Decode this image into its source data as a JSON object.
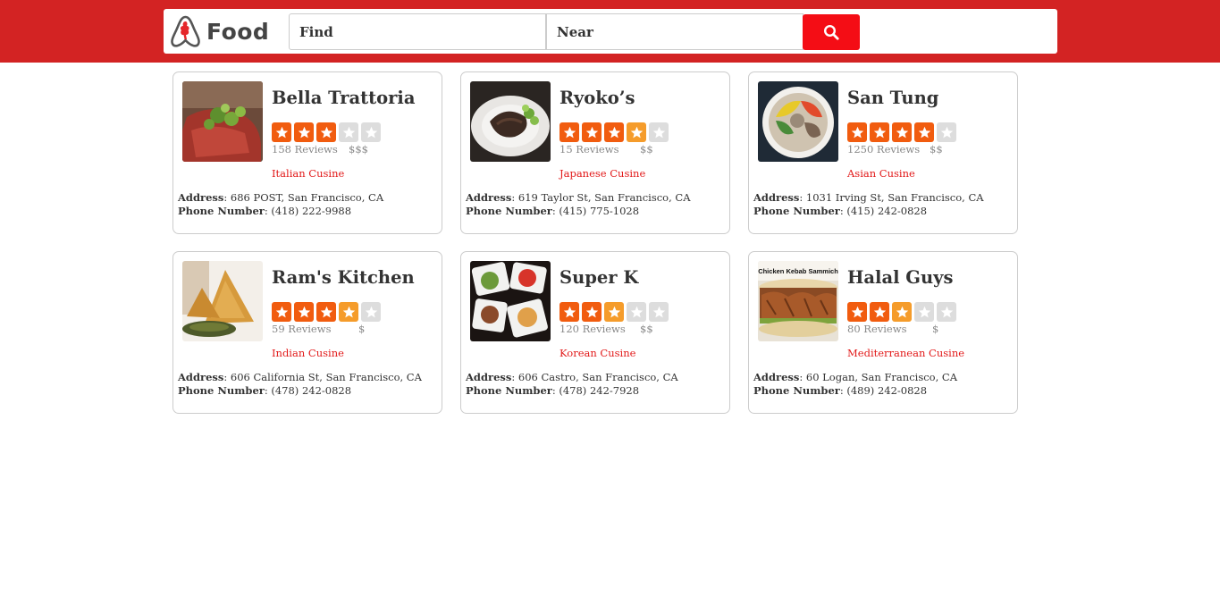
{
  "app": {
    "logo_text": "Food"
  },
  "search": {
    "find_placeholder": "Find",
    "near_placeholder": "Near",
    "button_icon": "search-icon"
  },
  "colors": {
    "topbar": "#d32323",
    "search_button": "#f40d15",
    "star_full": "#f15c0f",
    "star_half": "#f59c2b",
    "star_empty": "#dddddd",
    "cuisine": "#e21a1a"
  },
  "labels": {
    "address": "Address",
    "phone": "Phone Number"
  },
  "restaurants": [
    {
      "name": "Bella Trattoria",
      "rating": 3,
      "reviews": "158 Reviews",
      "price": "$$$",
      "cuisine": "Italian Cusine",
      "address": "686 POST, San Francisco, CA",
      "phone": "(418) 222-9988"
    },
    {
      "name": "Ryoko’s",
      "rating": 3.5,
      "reviews": "15 Reviews",
      "price": "$$",
      "cuisine": "Japanese Cusine",
      "address": "619 Taylor St, San Francisco, CA",
      "phone": "(415) 775-1028"
    },
    {
      "name": "San Tung",
      "rating": 4,
      "reviews": "1250 Reviews",
      "price": "$$",
      "cuisine": "Asian Cusine",
      "address": "1031 Irving St, San Francisco, CA",
      "phone": "(415) 242-0828"
    },
    {
      "name": "Ram's Kitchen",
      "rating": 3.5,
      "reviews": "59 Reviews",
      "price": "$",
      "cuisine": "Indian Cusine",
      "address": "606 California St, San Francisco, CA",
      "phone": "(478) 242-0828"
    },
    {
      "name": "Super K",
      "rating": 2.5,
      "reviews": "120 Reviews",
      "price": "$$",
      "cuisine": "Korean Cusine",
      "address": "606 Castro, San Francisco, CA",
      "phone": "(478) 242-7928"
    },
    {
      "name": "Halal Guys",
      "rating": 2.5,
      "reviews": "80 Reviews",
      "price": "$",
      "cuisine": "Mediterranean Cusine",
      "address": "60 Logan, San Francisco, CA",
      "phone": "(489) 242-0828",
      "image_text": "Chicken Kebab Sammich"
    }
  ]
}
